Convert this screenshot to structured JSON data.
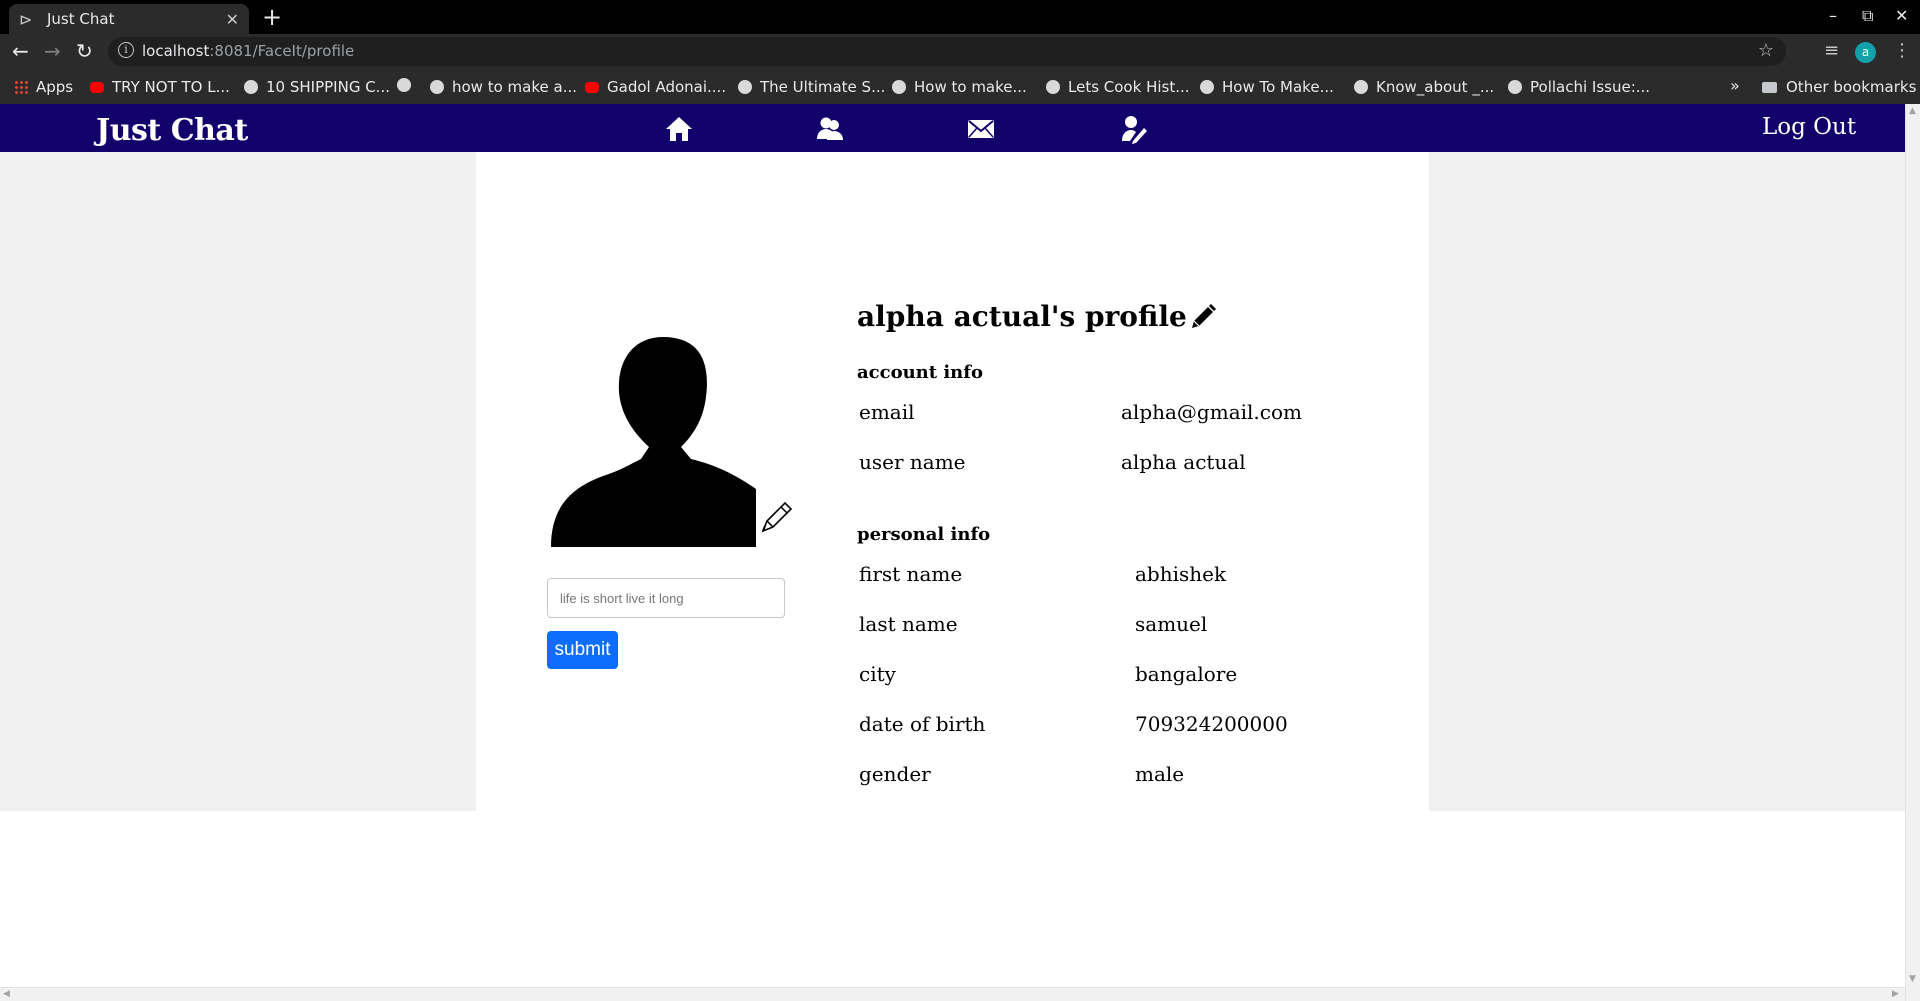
{
  "browser": {
    "tab_title": "Just Chat",
    "url_host": "localhost",
    "url_rest": ":8081/FaceIt/profile",
    "profile_initial": "a",
    "bookmarks": [
      {
        "label": "Apps",
        "icon": "apps-grid-icon"
      },
      {
        "label": "TRY NOT TO L...",
        "icon": "youtube-icon"
      },
      {
        "label": "10 SHIPPING C...",
        "icon": "globe-icon"
      },
      {
        "label": "",
        "icon": "globe-icon"
      },
      {
        "label": "how to make a...",
        "icon": "globe-icon"
      },
      {
        "label": "Gadol Adonai....",
        "icon": "youtube-icon"
      },
      {
        "label": "The Ultimate S...",
        "icon": "globe-icon"
      },
      {
        "label": "How to make...",
        "icon": "globe-icon"
      },
      {
        "label": "Lets Cook Hist...",
        "icon": "globe-icon"
      },
      {
        "label": "How To Make...",
        "icon": "globe-icon"
      },
      {
        "label": "Know_about _...",
        "icon": "globe-icon"
      },
      {
        "label": "Pollachi Issue:...",
        "icon": "globe-icon"
      }
    ],
    "other_bookmarks": "Other bookmarks"
  },
  "navbar": {
    "brand": "Just Chat",
    "icons": [
      "home-icon",
      "users-icon",
      "envelope-icon",
      "edit-user-icon"
    ],
    "logout": "Log Out",
    "color": "#12006b"
  },
  "profile": {
    "title": "alpha actual's profile",
    "status_placeholder": "life is short live it long",
    "submit_label": "submit",
    "account_heading": "account info",
    "account": [
      {
        "label": "email",
        "value": "alpha@gmail.com"
      },
      {
        "label": "user name",
        "value": "alpha actual"
      }
    ],
    "personal_heading": "personal info",
    "personal": [
      {
        "label": "first name",
        "value": "abhishek"
      },
      {
        "label": "last name",
        "value": "samuel"
      },
      {
        "label": "city",
        "value": "bangalore"
      },
      {
        "label": "date of birth",
        "value": "709324200000"
      },
      {
        "label": "gender",
        "value": "male"
      }
    ]
  },
  "colors": {
    "accent_button": "#0d6efd",
    "page_background": "#f0f0f0"
  }
}
